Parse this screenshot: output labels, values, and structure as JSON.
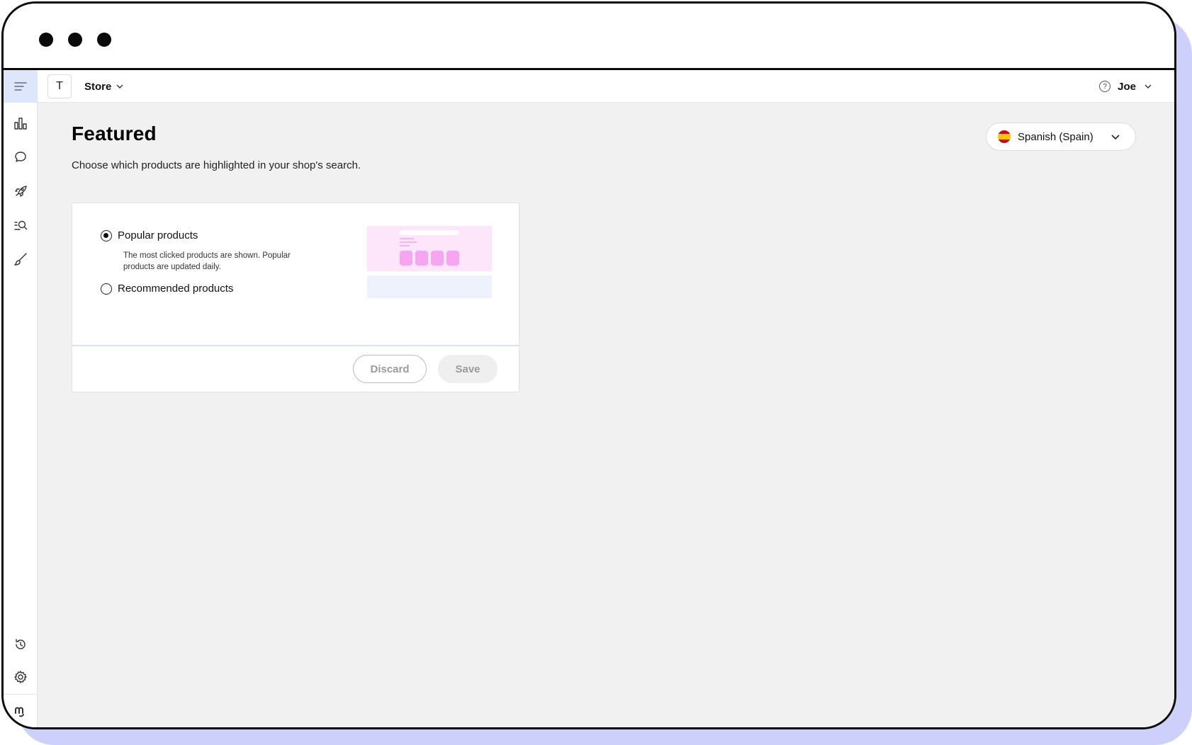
{
  "topbar": {
    "store_initial": "T",
    "store_label": "Store",
    "help_icon": "?",
    "user_name": "Joe"
  },
  "sidebar": {
    "items": [
      "menu-icon",
      "analytics-icon",
      "chat-icon",
      "rocket-icon",
      "search-list-icon",
      "brush-icon",
      "history-icon",
      "settings-icon",
      "brand-logo-icon"
    ]
  },
  "page": {
    "title": "Featured",
    "subtitle": "Choose which products are highlighted in your shop's search."
  },
  "language": {
    "selected": "Spanish (Spain)"
  },
  "options": [
    {
      "label": "Popular products",
      "description": "The most clicked products are shown. Popular products are updated daily.",
      "selected": true
    },
    {
      "label": "Recommended products",
      "selected": false
    }
  ],
  "buttons": {
    "discard": "Discard",
    "save": "Save"
  },
  "colors": {
    "accent_shadow": "#cdd0fb",
    "sidebar_active": "#dde6fb",
    "preview_pink": "#f6a6f0",
    "content_bg": "#f1f1f1"
  }
}
